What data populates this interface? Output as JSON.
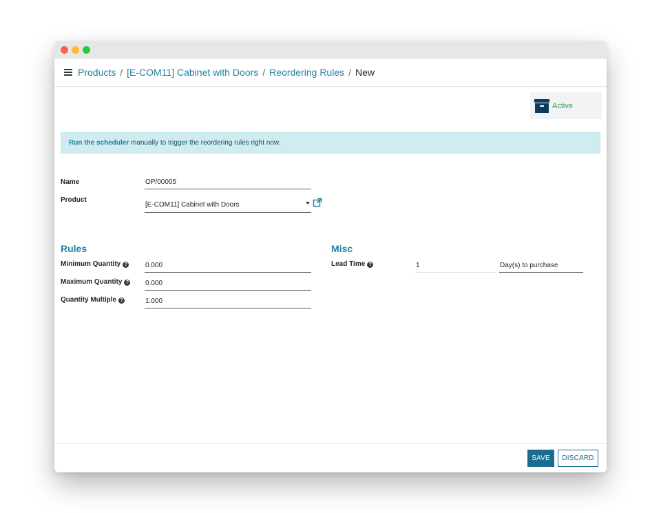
{
  "breadcrumb": {
    "items": [
      "Products",
      "[E-COM11] Cabinet with Doors",
      "Reordering Rules"
    ],
    "separator": "/",
    "current": "New"
  },
  "status": {
    "active_label": "Active",
    "icon": "archive-icon"
  },
  "alert": {
    "link_text": "Run the scheduler",
    "message": " manually to trigger the reordering rules right now."
  },
  "form": {
    "name_label": "Name",
    "name_value": "OP/00005",
    "product_label": "Product",
    "product_value": "[E-COM11] Cabinet with Doors"
  },
  "rules": {
    "title": "Rules",
    "min_label": "Minimum Quantity",
    "min_value": "0.000",
    "max_label": "Maximum Quantity",
    "max_value": "0.000",
    "multiple_label": "Quantity Multiple",
    "multiple_value": "1.000"
  },
  "misc": {
    "title": "Misc",
    "lead_time_label": "Lead Time",
    "lead_time_value": "1",
    "lead_time_unit": "Day(s) to purchase"
  },
  "help_icon_glyph": "?",
  "footer": {
    "save_label": "SAVE",
    "discard_label": "DISCARD"
  },
  "colors": {
    "link": "#1f7fa3",
    "primary_button": "#1a6c92",
    "alert_bg": "#d1ecf1",
    "active_text": "#28a745"
  }
}
